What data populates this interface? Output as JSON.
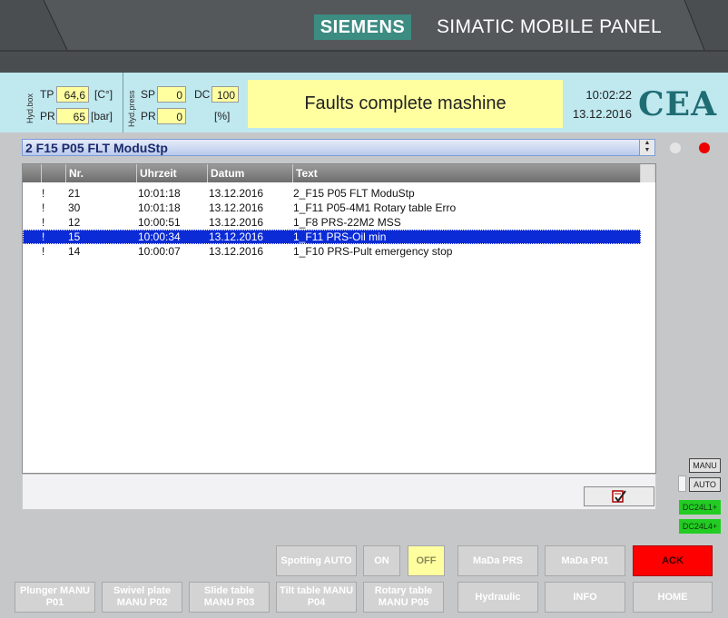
{
  "device": {
    "brand": "SIEMENS",
    "model": "SIMATIC MOBILE PANEL"
  },
  "header": {
    "hyd_box_label": "Hyd.box",
    "tp_label": "TP",
    "tp_value": "64,6",
    "tp_unit": "[C°]",
    "pr_label": "PR",
    "pr_value": "65",
    "pr_unit": "[bar]",
    "hyd_press_label": "Hyd.press",
    "sp_label": "SP",
    "sp_value": "0",
    "dc_label": "DC",
    "dc_value": "100",
    "pr2_label": "PR",
    "pr2_value": "0",
    "pr2_unit": "[%]",
    "message": "Faults complete mashine",
    "time": "10:02:22",
    "date": "13.12.2016",
    "logo": "CEA"
  },
  "selected_alarm": "2  F15 P05 FLT ModuStp",
  "table": {
    "columns": [
      "",
      "Nr.",
      "Uhrzeit",
      "Datum",
      "Text"
    ],
    "rows": [
      {
        "flag": "!",
        "nr": "21",
        "time": "10:01:18",
        "date": "13.12.2016",
        "text": "2_F15 P05 FLT ModuStp"
      },
      {
        "flag": "!",
        "nr": "30",
        "time": "10:01:18",
        "date": "13.12.2016",
        "text": "1_F11 P05-4M1 Rotary table Erro"
      },
      {
        "flag": "!",
        "nr": "12",
        "time": "10:00:51",
        "date": "13.12.2016",
        "text": "1_F8 PRS-22M2 MSS"
      },
      {
        "flag": "!",
        "nr": "15",
        "time": "10:00:34",
        "date": "13.12.2016",
        "text": "1_F11 PRS-Oil min"
      },
      {
        "flag": "!",
        "nr": "14",
        "time": "10:00:07",
        "date": "13.12.2016",
        "text": "1_F10 PRS-Pult emergency stop"
      }
    ],
    "selected_row": 3
  },
  "side": {
    "manu": "MANU",
    "auto": "AUTO",
    "dc1": "DC24L1+",
    "dc2": "DC24L4+"
  },
  "buttons": {
    "spotting": "Spotting AUTO",
    "on": "ON",
    "off": "OFF",
    "mada_prs": "MaDa PRS",
    "mada_p01": "MaDa P01",
    "ack": "ACK",
    "plunger": "Plunger MANU P01",
    "swivel": "Swivel plate MANU P02",
    "slide": "Slide table MANU P03",
    "tilt": "Tilt table MANU P04",
    "rotary": "Rotary table MANU P05",
    "hydraulic": "Hydraulic",
    "info": "INFO",
    "home": "HOME"
  },
  "colors": {
    "header_bg": "#bfe8ef",
    "field_bg": "#ffffa0",
    "selected_row": "#0b2bd6",
    "ack": "#ff0000",
    "dc_green": "#22cc22",
    "logo": "#1f6d73"
  }
}
